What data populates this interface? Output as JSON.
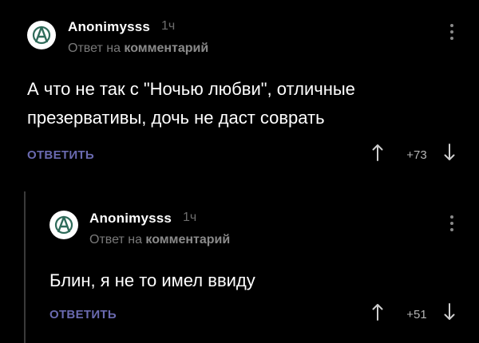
{
  "comments": [
    {
      "username": "Anonimysss",
      "time": "1ч",
      "reply_prefix": "Ответ на",
      "reply_target": "комментарий",
      "text_line1": "А что не так с \"Ночью любви\", отличные",
      "text_line2": "презервативы, дочь не даст соврать",
      "reply_label": "ОТВЕТИТЬ",
      "score": "+73"
    },
    {
      "username": "Anonimysss",
      "time": "1ч",
      "reply_prefix": "Ответ на",
      "reply_target": "комментарий",
      "text_line1": "Блин, я не то имел ввиду",
      "reply_label": "ОТВЕТИТЬ",
      "score": "+51"
    }
  ],
  "icons": {
    "avatar": "anarchy-symbol-icon",
    "menu": "kebab-menu-icon",
    "upvote": "arrow-up-icon",
    "downvote": "arrow-down-icon"
  },
  "colors": {
    "background": "#000000",
    "reply_button": "#6a6ab0",
    "muted_text": "#7a7a7a"
  }
}
